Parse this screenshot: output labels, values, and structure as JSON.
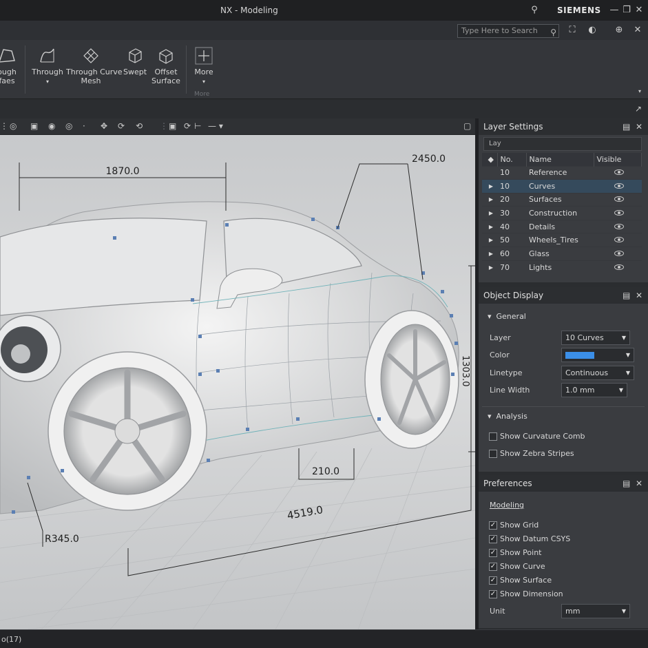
{
  "window": {
    "title": "NX - Modeling",
    "brand": "SIEMENS"
  },
  "search": {
    "placeholder": "Type Here to Search"
  },
  "ribbon": {
    "buttons": [
      {
        "label": "ough\nfaes"
      },
      {
        "label": "Through"
      },
      {
        "label": "Through Curve\nMesh"
      },
      {
        "label": "Swept"
      },
      {
        "label": "Offset\nSurface"
      },
      {
        "label": "More"
      }
    ],
    "group_label": "More"
  },
  "viewport": {
    "dimensions": [
      "1870.0",
      "2450.0",
      "1303.0",
      "210.0",
      "4519.0",
      "R345.0"
    ]
  },
  "layer_settings": {
    "title": "Layer Settings",
    "filter": "Lay",
    "columns": [
      "No.",
      "Name",
      "Visible"
    ],
    "rows": [
      {
        "no": "10",
        "name": "Reference"
      },
      {
        "no": "10",
        "name": "Curves"
      },
      {
        "no": "20",
        "name": "Surfaces"
      },
      {
        "no": "30",
        "name": "Construction"
      },
      {
        "no": "40",
        "name": "Details"
      },
      {
        "no": "50",
        "name": "Wheels_Tires"
      },
      {
        "no": "60",
        "name": "Glass"
      },
      {
        "no": "70",
        "name": "Lights"
      }
    ],
    "selected_row": 1
  },
  "object_display": {
    "title": "Object Display",
    "general_label": "General",
    "layer_label": "Layer",
    "layer_value": "10 Curves",
    "color_label": "Color",
    "color_value": "#3b8fe8",
    "linetype_label": "Linetype",
    "linetype_value": "Continuous",
    "linewidth_label": "Line Width",
    "linewidth_value": "1.0 mm",
    "analysis_label": "Analysis",
    "curvature_comb": "Show Curvature Comb",
    "zebra": "Show Zebra Stripes"
  },
  "preferences": {
    "title": "Preferences",
    "modeling_label": "Modeling",
    "options": [
      "Show Grid",
      "Show Datum CSYS",
      "Show Point",
      "Show Curve",
      "Show Surface",
      "Show Dimension"
    ],
    "unit_label": "Unit",
    "unit_value": "mm"
  },
  "status": {
    "text": "o(17)"
  }
}
